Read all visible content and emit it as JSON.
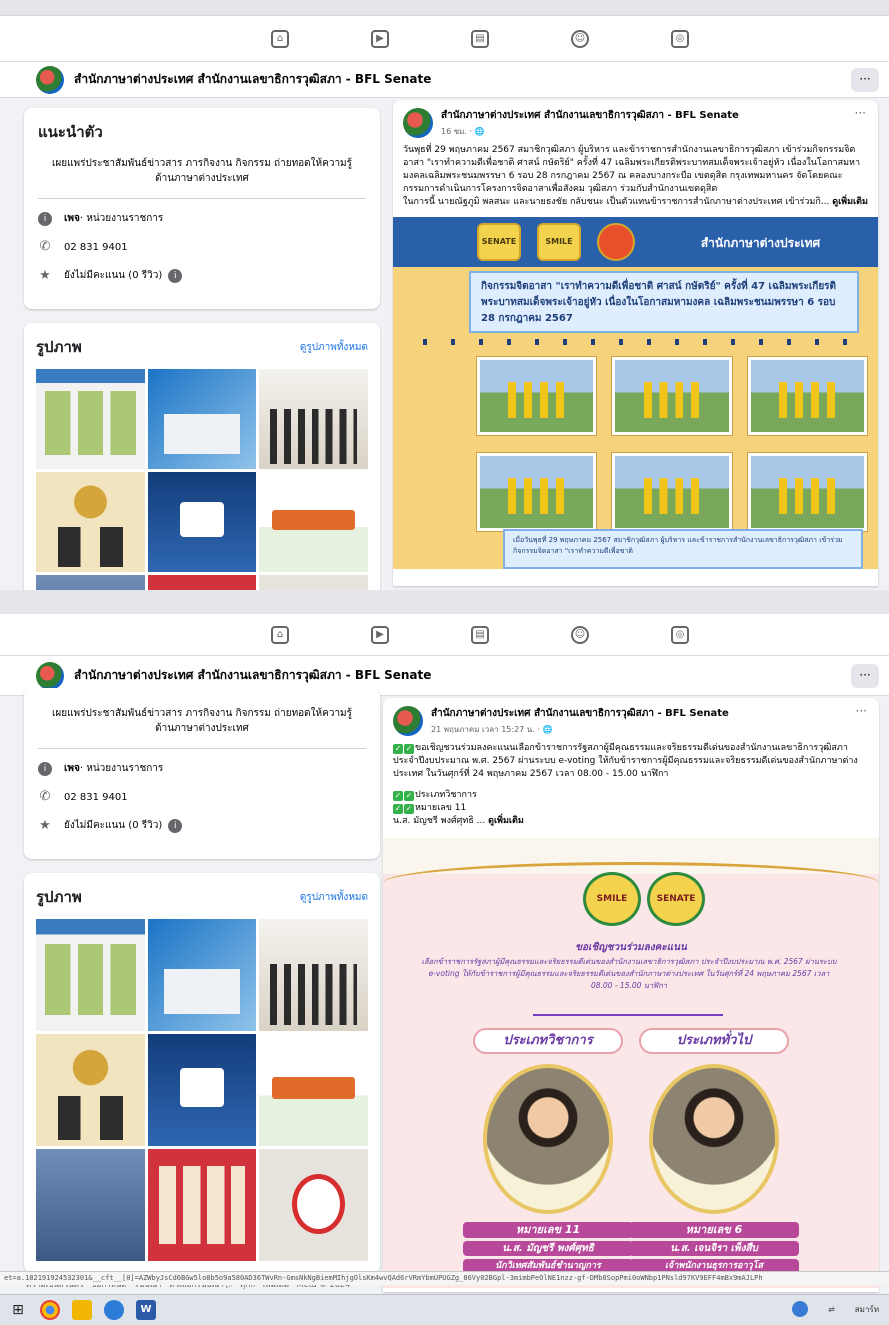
{
  "browser": {
    "nav_icons": [
      "home-icon",
      "video-icon",
      "marketplace-icon",
      "groups-icon",
      "gaming-icon"
    ],
    "url": "et=a.182191924532301&__cft__[0]=AZWbyJsCd6BGw5lo8b5o9a580AD36TWvRn-GmsNkNgBiemMIhjgOlsKm4wvQAd6rVRmYbmUPUGZg_86Vy02BGpl-3mimbPeOlNE1nzz-gf-DMb0SopPmi0oWNbp1PNsld97KV9EFF4mBx9mAJLPh"
  },
  "page": {
    "name": "สำนักภาษาต่างประเทศ สำนักงานเลขาธิการวุฒิสภา - BFL Senate",
    "more": "···"
  },
  "intro": {
    "title": "แนะนำตัว",
    "description": "เผยแพร่ประชาสัมพันธ์ข่าวสาร ภารกิจงาน กิจกรรม ถ่ายทอดให้ความรู้ด้านภาษาต่างประเทศ",
    "category_label": "เพจ",
    "category_value": " · หน่วยงานราชการ",
    "phone": "02 831 9401",
    "rating": "ยังไม่มีคะแนน (0 รีวิว)"
  },
  "photos": {
    "title": "รูปภาพ",
    "see_all": "ดูรูปภาพทั้งหมด"
  },
  "footer": {
    "links": "ความเป็นส่วนตัว · ข้อกำหนด · โฆษณา · ตัวเลือกโฆษณา ▷ · คุกกี้ · เพิ่มเติม · Meta © 2024"
  },
  "post1": {
    "author": "สำนักภาษาต่างประเทศ สำนักงานเลขาธิการวุฒิสภา - BFL Senate",
    "time": "16 ชม. · 🌐",
    "text": "วันพุธที่ 29 พฤษภาคม 2567 สมาชิกวุฒิสภา ผู้บริหาร และข้าราชการสำนักงานเลขาธิการวุฒิสภา เข้าร่วมกิจกรรมจิตอาสา \"เราทำความดีเพื่อชาติ ศาสน์ กษัตริย์\" ครั้งที่ 47 เฉลิมพระเกียรติพระบาทสมเด็จพระเจ้าอยู่หัว เนื่องในโอกาสมหามงคลเฉลิมพระชนมพรรษา 6 รอบ 28 กรกฎาคม 2567 ณ คลองบางกระบือ เขตดุสิต กรุงเทพมหานคร จัดโดยคณะกรรมการดำเนินการโครงการจิตอาสาเพื่อสังคม วุฒิสภา ร่วมกับสำนักงานเขตดุสิต\nในการนี้ นายณัฐภูมิ พลสนะ และนายธงชัย กลับชนะ เป็นตัวแทนข้าราชการสำนักภาษาต่างประเทศ เข้าร่วมกิ... ",
    "see_more": "ดูเพิ่มเติม",
    "poster": {
      "logo1": "SENATE",
      "logo2": "SMILE",
      "org": "สำนักภาษาต่างประเทศ",
      "title": "กิจกรรมจิตอาสา \"เราทำความดีเพื่อชาติ ศาสน์ กษัตริย์\" ครั้งที่ 47 เฉลิมพระเกียรติพระบาทสมเด็จพระเจ้าอยู่หัว เนื่องในโอกาสมหามงคล เฉลิมพระชนมพรรษา 6 รอบ 28 กรกฎาคม 2567",
      "caption": "เมื่อวันพุธที่ 29 พฤษภาคม 2567 สมาชิกวุฒิสภา ผู้บริหาร และข้าราชการสำนักงานเลขาธิการวุฒิสภา เข้าร่วมกิจกรรมจิตอาสา \"เราทำความดีเพื่อชาติ"
    }
  },
  "post2": {
    "author": "สำนักภาษาต่างประเทศ สำนักงานเลขาธิการวุฒิสภา - BFL Senate",
    "time": "21 พฤษภาคม เวลา 15:27 น. · 🌐",
    "text": "ขอเชิญชวนร่วมลงคะแนนเลือกข้าราชการรัฐสภาผู้มีคุณธรรมและจริยธรรมดีเด่นของสำนักงานเลขาธิการวุฒิสภา ประจำปีงบประมาณ พ.ศ. 2567 ผ่านระบบ e-voting ให้กับข้าราชการผู้มีคุณธรรมและจริยธรรมดีเด่นของสำนักภาษาต่างประเทศ ในวันศุกร์ที่ 24 พฤษภาคม 2567 เวลา 08.00 - 15.00 นาฬิกา",
    "line1": "ประเภทวิชาการ",
    "line2": "หมายเลข 11",
    "line3": "น.ส. มัญชรี พงศ์ศุทธิ ... ",
    "see_more": "ดูเพิ่มเติม",
    "poster": {
      "logo1": "SMILE",
      "logo2": "SENATE",
      "heading": "ขอเชิญชวนร่วมลงคะแนน",
      "body": "เลือกข้าราชการรัฐสภาผู้มีคุณธรรมและจริยธรรมดีเด่นของสำนักงานเลขาธิการวุฒิสภา ประจำปีงบประมาณ พ.ศ. 2567 ผ่านระบบ e-voting ให้กับข้าราชการผู้มีคุณธรรมและจริยธรรมดีเด่นของสำนักภาษาต่างประเทศ ในวันศุกร์ที่ 24 พฤษภาคม 2567 เวลา 08.00 - 15.00 นาฬิกา",
      "cat_left": "ประเภทวิชาการ",
      "cat_right": "ประเภททั่วไป",
      "num_left": "หมายเลข 11",
      "num_right": "หมายเลข 6",
      "name_left": "น.ส. มัญชรี พงศ์ศุทธิ",
      "name_right": "น.ส. เจนจิรา เพ็งสืบ",
      "pos_left": "นักวิเทศสัมพันธ์ชำนาญการ",
      "pos_right": "เจ้าพนักงานธุรการอาวุโส"
    }
  },
  "taskbar": {
    "tray_text": "สมาร์ท"
  }
}
